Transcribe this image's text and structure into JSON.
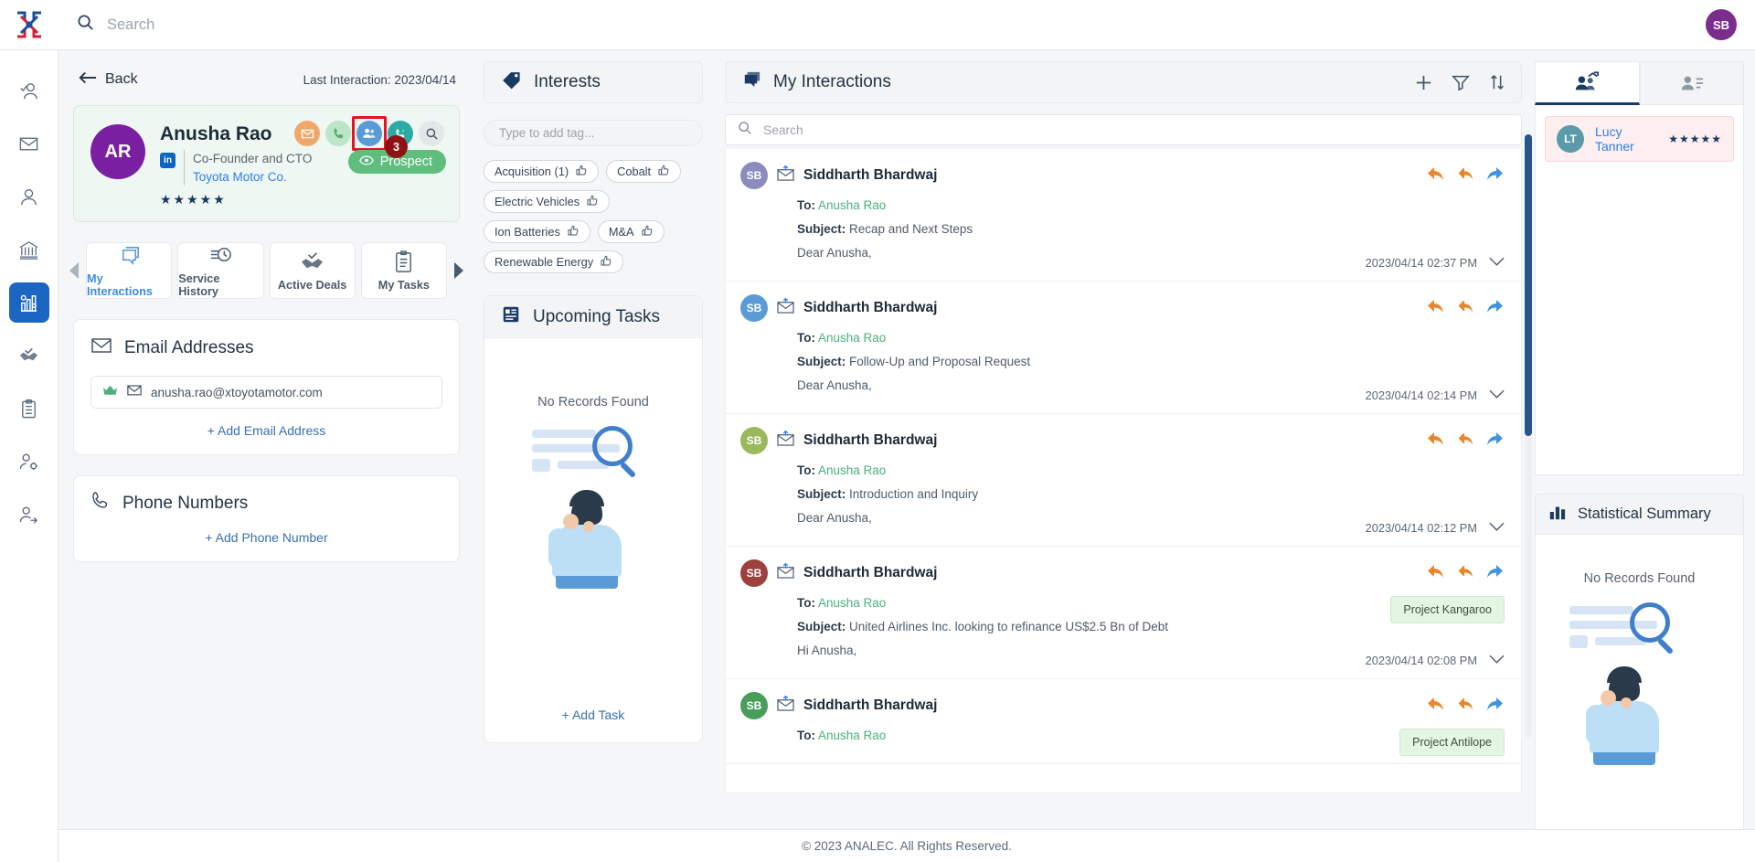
{
  "topbar": {
    "search_placeholder": "Search",
    "search_value": "",
    "user_initials": "SB",
    "search_icon": "search-icon",
    "logo_icon": "analec-logo-icon"
  },
  "rail": {
    "items": [
      {
        "icon": "user-check-icon",
        "name": "sidebar-item-contacts",
        "active": false
      },
      {
        "icon": "envelope-icon",
        "name": "sidebar-item-mail",
        "active": false
      },
      {
        "icon": "person-icon",
        "name": "sidebar-item-clients",
        "active": false
      },
      {
        "icon": "bank-icon",
        "name": "sidebar-item-institutions",
        "active": false
      },
      {
        "icon": "analytics-gear-icon",
        "name": "sidebar-item-insights",
        "active": true
      },
      {
        "icon": "handshake-icon",
        "name": "sidebar-item-deals",
        "active": false
      },
      {
        "icon": "clipboard-icon",
        "name": "sidebar-item-tasks",
        "active": false
      },
      {
        "icon": "user-settings-icon",
        "name": "sidebar-item-admin",
        "active": false
      },
      {
        "icon": "user-share-icon",
        "name": "sidebar-item-share",
        "active": false
      }
    ]
  },
  "profile": {
    "back_label": "Back",
    "back_icon": "arrow-left-icon",
    "last_interaction_label": "Last Interaction: 2023/04/14",
    "avatar_initials": "AR",
    "avatar_color": "#7b1fa2",
    "name": "Anusha Rao",
    "role": "Co-Founder and CTO",
    "company": "Toyota Motor Co.",
    "linkedin_label": "in",
    "rating": 5,
    "actions": [
      {
        "icon": "mail-icon",
        "name": "action-send-email",
        "style": "mail",
        "highlighted": false
      },
      {
        "icon": "phone-icon",
        "name": "action-call",
        "style": "phone",
        "highlighted": false
      },
      {
        "icon": "meeting-icon",
        "name": "action-log-meeting",
        "style": "meet",
        "highlighted": true
      },
      {
        "icon": "phone-message-icon",
        "name": "action-log-call",
        "style": "call2",
        "highlighted": false
      },
      {
        "icon": "search-icon",
        "name": "action-search-contact",
        "style": "srch",
        "highlighted": false
      }
    ],
    "badge_count": "3",
    "status_label": "Prospect",
    "status_icon": "eye-icon",
    "status_color": "#5fbd7e"
  },
  "tabs": {
    "left_arrow_icon": "chevron-left-icon",
    "right_arrow_icon": "chevron-right-icon",
    "items": [
      {
        "label": "My Interactions",
        "icon": "chat-stack-icon",
        "active": true
      },
      {
        "label": "Service History",
        "icon": "history-clock-icon",
        "active": false
      },
      {
        "label": "Active Deals",
        "icon": "handshake-icon",
        "active": false
      },
      {
        "label": "My Tasks",
        "icon": "clipboard-icon",
        "active": false
      }
    ]
  },
  "email_section": {
    "title": "Email Addresses",
    "icon": "envelope-icon",
    "rows": [
      {
        "value": "anusha.rao@xtoyotamotor.com",
        "lead_icon": "crown-icon",
        "mail_icon": "envelope-icon"
      }
    ],
    "add_label": "+ Add Email Address"
  },
  "phone_section": {
    "title": "Phone Numbers",
    "icon": "phone-icon",
    "add_label": "+ Add Phone Number"
  },
  "interests": {
    "title": "Interests",
    "icon": "tag-icon",
    "input_placeholder": "Type to add tag...",
    "tags": [
      {
        "label": "Acquisition (1)",
        "icon": "thumbs-up-icon"
      },
      {
        "label": "Cobalt",
        "icon": "thumbs-up-icon"
      },
      {
        "label": "Electric Vehicles",
        "icon": "thumbs-up-icon"
      },
      {
        "label": "Ion Batteries",
        "icon": "thumbs-up-icon"
      },
      {
        "label": "M&A",
        "icon": "thumbs-up-icon"
      },
      {
        "label": "Renewable Energy",
        "icon": "thumbs-up-icon"
      }
    ]
  },
  "upcoming_tasks": {
    "title": "Upcoming Tasks",
    "icon": "task-board-icon",
    "empty_text": "No Records Found",
    "add_label": "+ Add Task"
  },
  "interactions": {
    "title": "My Interactions",
    "icon": "chat-stack-icon",
    "header_actions": [
      {
        "icon": "plus-icon",
        "name": "add-interaction-button"
      },
      {
        "icon": "filter-icon",
        "name": "filter-interactions-button"
      },
      {
        "icon": "sort-icon",
        "name": "sort-interactions-button"
      }
    ],
    "search_placeholder": "Search",
    "search_value": "",
    "reply_icon": "reply-icon",
    "reply_all_icon": "reply-all-icon",
    "forward_icon": "forward-icon",
    "expand_icon": "chevron-down-icon",
    "type_icon": "email-sent-icon",
    "to_label": "To:",
    "subject_label": "Subject:",
    "rows": [
      {
        "initials": "SB",
        "avatar_color": "#8b8bbd",
        "sender": "Siddharth Bhardwaj",
        "to": "Anusha Rao",
        "subject": "Recap and Next Steps",
        "preview": "Dear Anusha,",
        "timestamp": "2023/04/14 02:37 PM",
        "tag": ""
      },
      {
        "initials": "SB",
        "avatar_color": "#5b9bd5",
        "sender": "Siddharth Bhardwaj",
        "to": "Anusha Rao",
        "subject": "Follow-Up and Proposal Request",
        "preview": "Dear Anusha,",
        "timestamp": "2023/04/14 02:14 PM",
        "tag": ""
      },
      {
        "initials": "SB",
        "avatar_color": "#9ab85c",
        "sender": "Siddharth Bhardwaj",
        "to": "Anusha Rao",
        "subject": "Introduction and Inquiry",
        "preview": "Dear Anusha,",
        "timestamp": "2023/04/14 02:12 PM",
        "tag": ""
      },
      {
        "initials": "SB",
        "avatar_color": "#9e4040",
        "sender": "Siddharth Bhardwaj",
        "to": "Anusha Rao",
        "subject": "United Airlines Inc. looking to refinance US$2.5 Bn of Debt",
        "preview": "Hi Anusha,",
        "timestamp": "2023/04/14 02:08 PM",
        "tag": "Project Kangaroo"
      },
      {
        "initials": "SB",
        "avatar_color": "#4a9e5c",
        "sender": "Siddharth Bhardwaj",
        "to": "Anusha Rao",
        "subject": "",
        "preview": "",
        "timestamp": "",
        "tag": "Project Antilope"
      }
    ]
  },
  "right_panel": {
    "tabs": [
      {
        "icon": "team-growth-icon",
        "name": "tab-related-contacts",
        "active": true
      },
      {
        "icon": "contact-card-icon",
        "name": "tab-contact-details",
        "active": false
      }
    ],
    "contacts": [
      {
        "initials": "LT",
        "name": "Lucy Tanner",
        "rating": 5
      }
    ],
    "statistical_summary": {
      "title": "Statistical Summary",
      "icon": "bar-chart-icon",
      "empty_text": "No Records Found"
    }
  },
  "footer": {
    "text": "© 2023 ANALEC. All Rights Reserved."
  }
}
